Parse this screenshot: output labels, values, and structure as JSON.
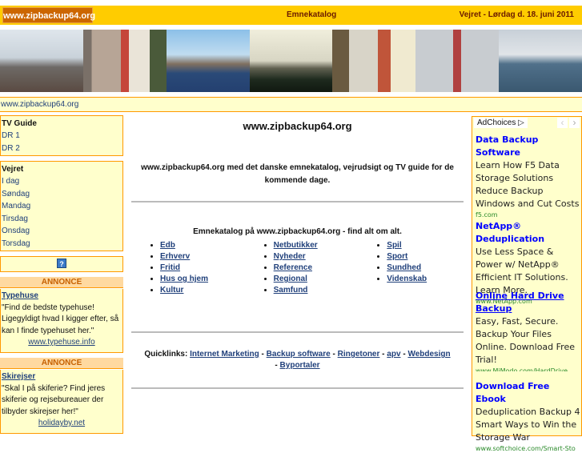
{
  "header": {
    "logo": "www.zipbackup64.org",
    "catalog": "Emnekatalog",
    "date": "Vejret - Lørdag d. 18. juni 2011"
  },
  "banner": {
    "photos": [
      "city-skyline",
      "street",
      "canal",
      "bridge",
      "lane",
      "lighthouse",
      "harbor"
    ]
  },
  "breadcrumb": "www.zipbackup64.org",
  "sidebar": {
    "tv": {
      "title": "TV Guide",
      "items": [
        "DR 1",
        "DR 2"
      ]
    },
    "weather": {
      "title": "Vejret",
      "items": [
        "I dag",
        "Søndag",
        "Mandag",
        "Tirsdag",
        "Onsdag",
        "Torsdag"
      ]
    },
    "help_icon": "?",
    "ads": [
      {
        "label": "ANNONCE",
        "title": "Typehuse",
        "text": "\"Find de bedste typehuse! Ligegyldigt hvad I kigger efter, så kan I finde typehuset her.\"",
        "url": "www.typehuse.info"
      },
      {
        "label": "ANNONCE",
        "title": "Skirejser",
        "text": "\"Skal I på skiferie? Find jeres skiferie og rejsebureauer der tilbyder skirejser her!\"",
        "url": "holidayby.net"
      }
    ]
  },
  "main": {
    "title": "www.zipbackup64.org",
    "intro": "www.zipbackup64.org med det danske emnekatalog, vejrudsigt og TV guide for de kommende dage.",
    "catalog_heading": "Emnekatalog på www.zipbackup64.org - find alt om alt.",
    "columns": [
      [
        "Edb",
        "Erhverv",
        "Fritid",
        "Hus og hjem",
        "Kultur"
      ],
      [
        "Netbutikker",
        "Nyheder",
        "Reference",
        "Regional",
        "Samfund"
      ],
      [
        "Spil",
        "Sport",
        "Sundhed",
        "Videnskab"
      ]
    ],
    "quicklinks_label": "Quicklinks:",
    "quicklinks": [
      "Internet Marketing",
      "Backup software",
      "Ringetoner",
      "apv",
      "Webdesign",
      "Byportaler"
    ],
    "sep": "-"
  },
  "right_ads": {
    "adchoices": "AdChoices ▷",
    "prev": "‹",
    "next": "›",
    "items": [
      {
        "title": "Data Backup Software",
        "text": "Learn How F5 Data Storage Solutions Reduce Backup Windows and Cut Costs",
        "url": "f5.com"
      },
      {
        "title": "NetApp® Deduplication",
        "text": "Use Less Space & Power w/ NetApp® Efficient IT Solutions. Learn More.",
        "url": "www.NetApp.com"
      },
      {
        "title": "Online Hard Drive Backup",
        "text": "Easy, Fast, Secure. Backup Your Files Online. Download Free Trial!",
        "url": "www.MiModo.com/HardDrive"
      },
      {
        "title": "Download Free Ebook",
        "text": "Deduplication Backup 4 Smart Ways to Win the Storage War",
        "url": "www.softchoice.com/Smart-Sto"
      }
    ]
  }
}
